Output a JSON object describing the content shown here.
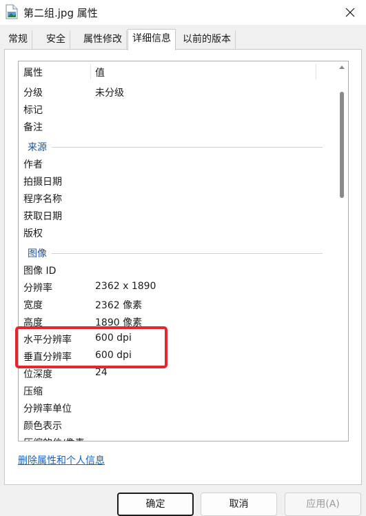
{
  "window": {
    "title": "第二组.jpg 属性"
  },
  "tabs": [
    {
      "label": "常规",
      "active": false
    },
    {
      "label": "安全",
      "active": false
    },
    {
      "label": "属性修改",
      "active": false
    },
    {
      "label": "详细信息",
      "active": true
    },
    {
      "label": "以前的版本",
      "active": false
    }
  ],
  "list": {
    "columns": [
      "属性",
      "值"
    ],
    "rows": [
      {
        "key": "分级",
        "value": "未分级"
      },
      {
        "key": "标记",
        "value": ""
      },
      {
        "key": "备注",
        "value": ""
      },
      {
        "group": "来源"
      },
      {
        "key": "作者",
        "value": ""
      },
      {
        "key": "拍摄日期",
        "value": ""
      },
      {
        "key": "程序名称",
        "value": ""
      },
      {
        "key": "获取日期",
        "value": ""
      },
      {
        "key": "版权",
        "value": ""
      },
      {
        "group": "图像"
      },
      {
        "key": "图像 ID",
        "value": ""
      },
      {
        "key": "分辨率",
        "value": "2362 x 1890"
      },
      {
        "key": "宽度",
        "value": "2362 像素"
      },
      {
        "key": "高度",
        "value": "1890 像素"
      },
      {
        "key": "水平分辨率",
        "value": "600 dpi"
      },
      {
        "key": "垂直分辨率",
        "value": "600 dpi"
      },
      {
        "key": "位深度",
        "value": "24"
      },
      {
        "key": "压缩",
        "value": ""
      },
      {
        "key": "分辨率单位",
        "value": ""
      },
      {
        "key": "颜色表示",
        "value": ""
      },
      {
        "key": "压缩的位/像素",
        "value": ""
      }
    ]
  },
  "links": {
    "delete_properties": "删除属性和个人信息"
  },
  "buttons": {
    "ok": "确定",
    "cancel": "取消",
    "apply": "应用(A)"
  },
  "colors": {
    "highlight": "#e8252e",
    "group_text": "#1e56a0",
    "link": "#1463c4"
  }
}
